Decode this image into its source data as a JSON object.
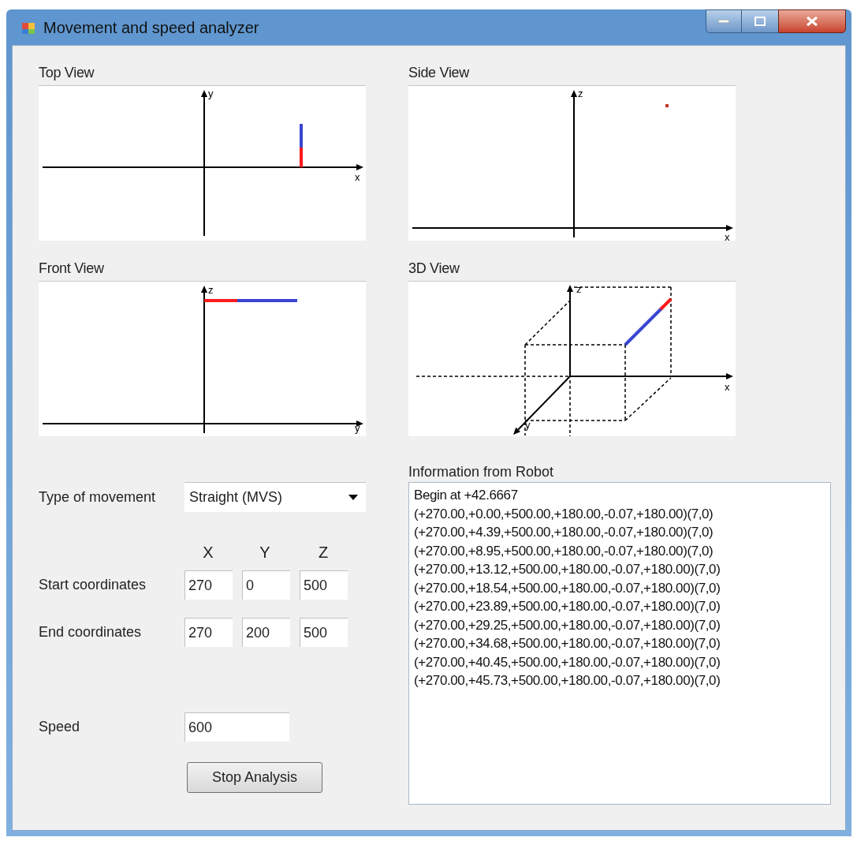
{
  "window": {
    "title": "Movement and speed analyzer"
  },
  "views": [
    {
      "title": "Top View",
      "kind": "top",
      "axes": [
        "y",
        "x"
      ]
    },
    {
      "title": "Side View",
      "kind": "side",
      "axes": [
        "z",
        "x"
      ]
    },
    {
      "title": "Front View",
      "kind": "front",
      "axes": [
        "z",
        "y"
      ]
    },
    {
      "title": "3D View",
      "kind": "perspective",
      "axes": [
        "z",
        "x",
        "y"
      ]
    }
  ],
  "form": {
    "movement_label": "Type of movement",
    "movement_value": "Straight (MVS)",
    "column_headers": [
      "X",
      "Y",
      "Z"
    ],
    "rows": [
      {
        "label": "Start coordinates",
        "values": [
          "270",
          "0",
          "500"
        ]
      },
      {
        "label": "End coordinates",
        "values": [
          "270",
          "200",
          "500"
        ]
      }
    ],
    "speed_label": "Speed",
    "speed_value": "600",
    "button": "Stop Analysis"
  },
  "info": {
    "label": "Information from Robot",
    "lines": [
      "Begin at +42.6667",
      "(+270.00,+0.00,+500.00,+180.00,-0.07,+180.00)(7,0)",
      "(+270.00,+4.39,+500.00,+180.00,-0.07,+180.00)(7,0)",
      "(+270.00,+8.95,+500.00,+180.00,-0.07,+180.00)(7,0)",
      "(+270.00,+13.12,+500.00,+180.00,-0.07,+180.00)(7,0)",
      "(+270.00,+18.54,+500.00,+180.00,-0.07,+180.00)(7,0)",
      "(+270.00,+23.89,+500.00,+180.00,-0.07,+180.00)(7,0)",
      "(+270.00,+29.25,+500.00,+180.00,-0.07,+180.00)(7,0)",
      "(+270.00,+34.68,+500.00,+180.00,-0.07,+180.00)(7,0)",
      "(+270.00,+40.45,+500.00,+180.00,-0.07,+180.00)(7,0)",
      "(+270.00,+45.73,+500.00,+180.00,-0.07,+180.00)(7,0)"
    ]
  }
}
